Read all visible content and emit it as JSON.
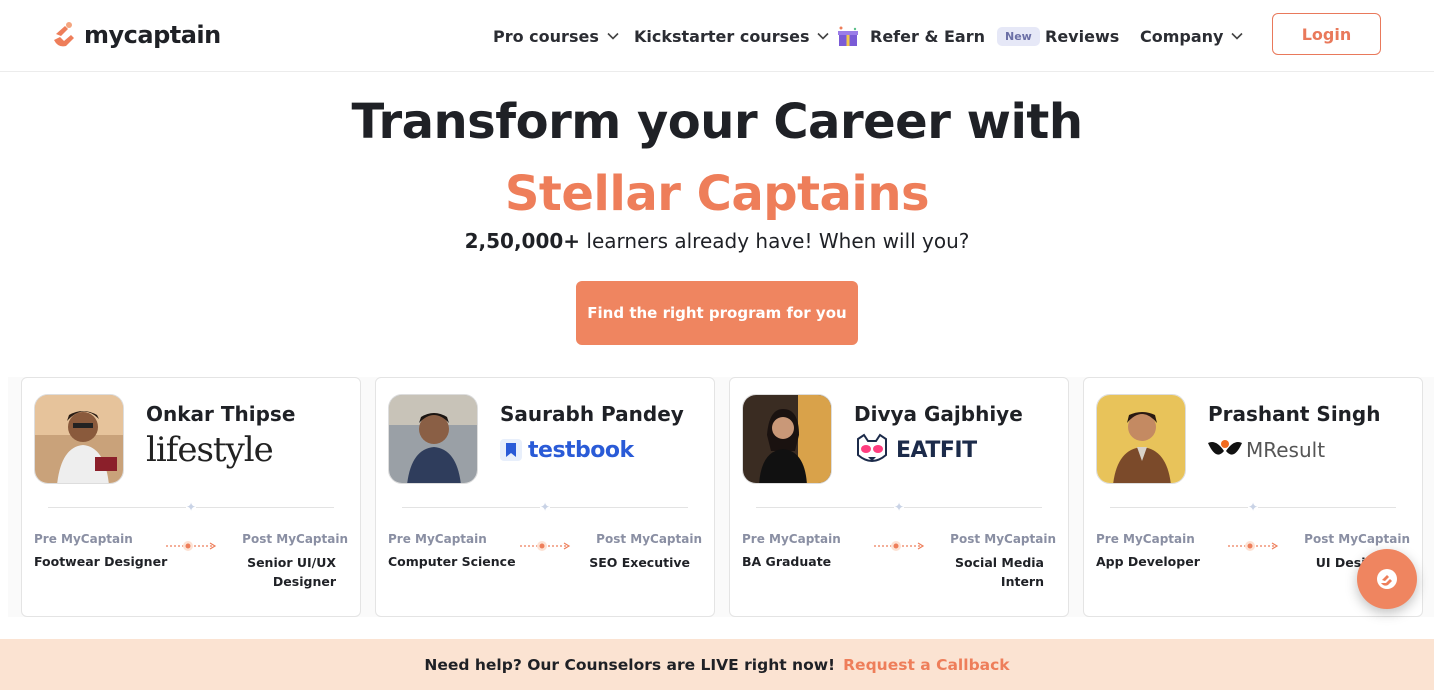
{
  "brand": {
    "name": "mycaptain",
    "accent": "#ee7e5a"
  },
  "nav": {
    "pro_courses": "Pro courses",
    "kickstarter_courses": "Kickstarter courses",
    "refer_earn": "Refer & Earn",
    "new_badge": "New",
    "reviews": "Reviews",
    "company": "Company",
    "login": "Login"
  },
  "hero": {
    "title_line1": "Transform your Career with",
    "title_line2": "Stellar Captains",
    "sub_bold": "2,50,000+",
    "sub_rest": " learners already have! When will you?",
    "cta": "Find the right program for you"
  },
  "cards": [
    {
      "name": "Onkar Thipse",
      "company": "lifestyle",
      "pre_label": "Pre MyCaptain",
      "pre_role": "Footwear Designer",
      "post_label": "Post MyCaptain",
      "post_role": "Senior UI/UX Designer"
    },
    {
      "name": "Saurabh Pandey",
      "company": "testbook",
      "pre_label": "Pre MyCaptain",
      "pre_role": "Computer Science",
      "post_label": "Post MyCaptain",
      "post_role": "SEO Executive"
    },
    {
      "name": "Divya Gajbhiye",
      "company": "EATFIT",
      "pre_label": "Pre MyCaptain",
      "pre_role": "BA Graduate",
      "post_label": "Post MyCaptain",
      "post_role": "Social Media Intern"
    },
    {
      "name": "Prashant Singh",
      "company": "MResult",
      "pre_label": "Pre MyCaptain",
      "pre_role": "App Developer",
      "post_label": "Post MyCaptain",
      "post_role": "UI Designer"
    }
  ],
  "banner": {
    "text": "Need help? Our Counselors are LIVE right now!",
    "link": "Request a Callback"
  }
}
